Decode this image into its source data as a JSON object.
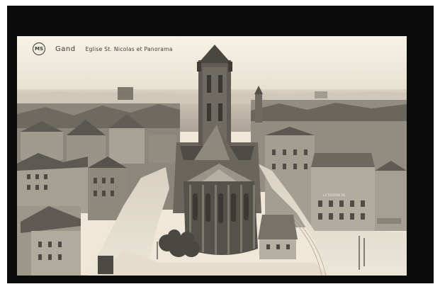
{
  "postcard": {
    "logo_text": "MS",
    "city": "Gand",
    "title": "Eglise St. Nicolas et Panorama"
  },
  "colors": {
    "mount": "#0b0b0b",
    "sky": "#f3eee0",
    "stone_dark": "#55524c",
    "stone_mid": "#7b776e",
    "roof_light": "#a9a397",
    "street": "#ddd6c6"
  },
  "sign_text": "LA TAVERNE DE"
}
